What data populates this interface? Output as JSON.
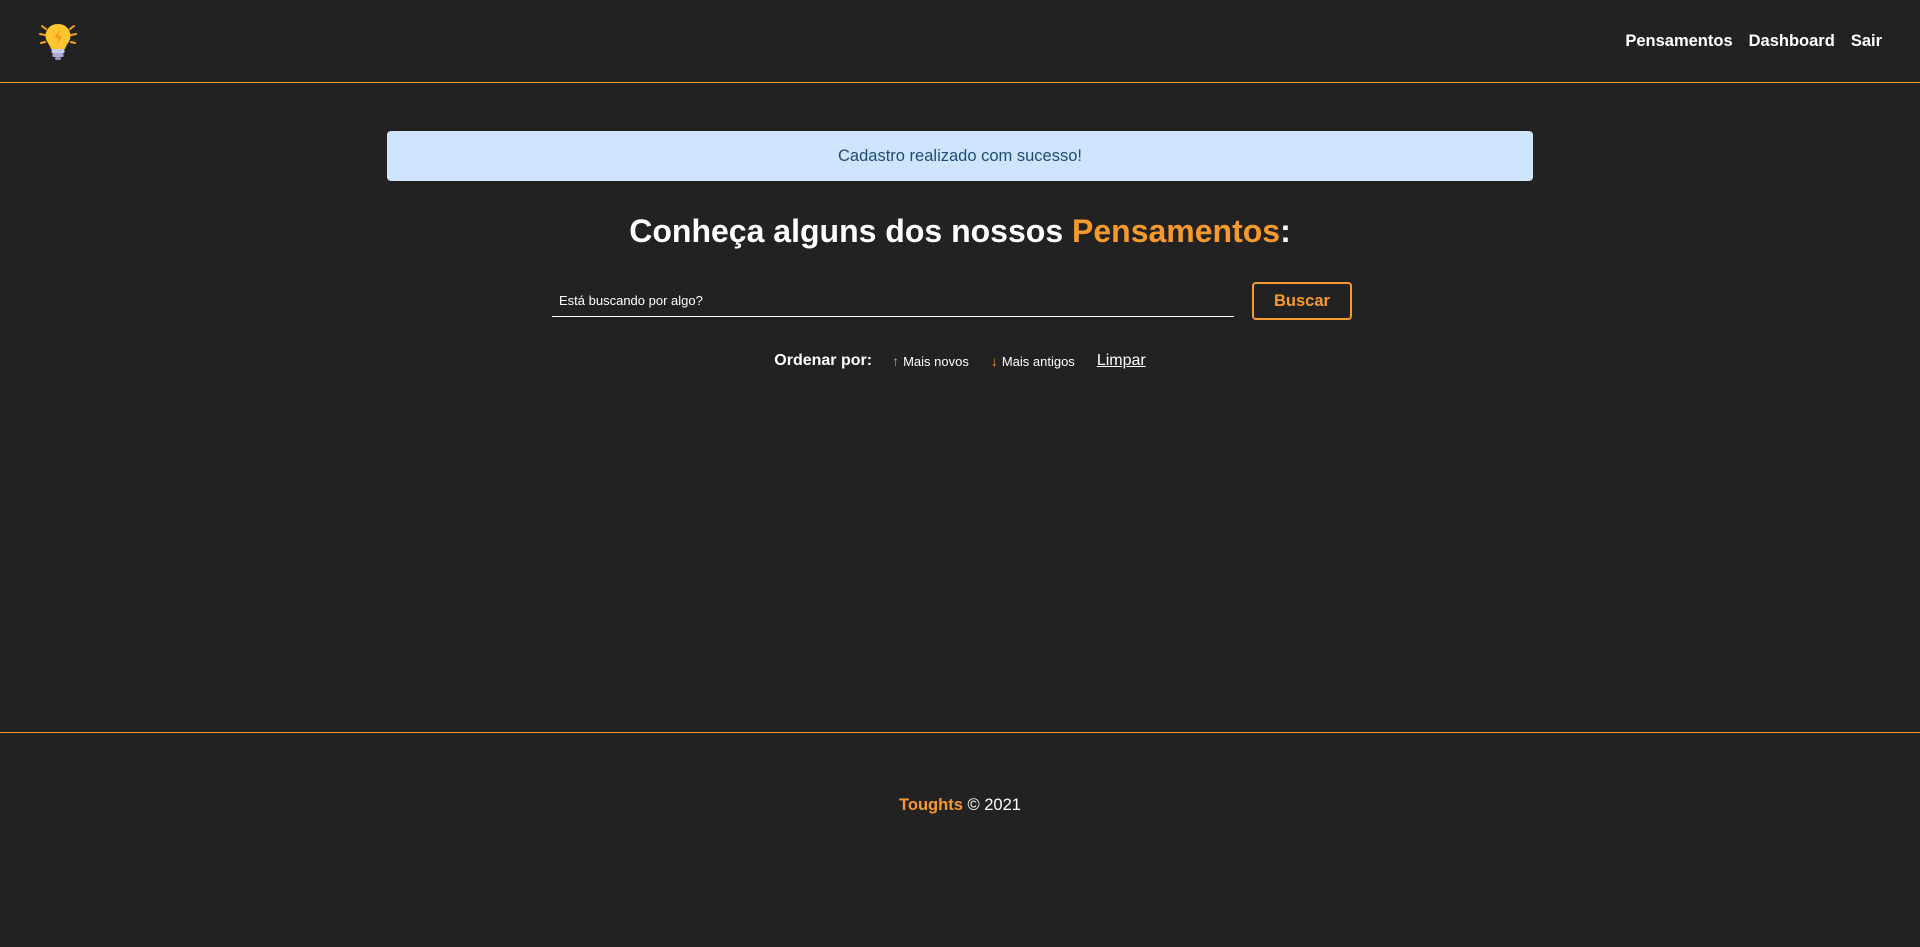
{
  "navbar": {
    "logo_icon": "light-bulb-icon",
    "links": [
      {
        "label": "Pensamentos"
      },
      {
        "label": "Dashboard"
      },
      {
        "label": "Sair"
      }
    ]
  },
  "flash": {
    "message": "Cadastro realizado com sucesso!"
  },
  "headline": {
    "prefix": "Conheça alguns dos nossos ",
    "highlight": "Pensamentos",
    "suffix": ":"
  },
  "search": {
    "placeholder": "Está buscando por algo?",
    "button_label": "Buscar"
  },
  "order": {
    "label": "Ordenar por:",
    "newest_arrow": "↑",
    "newest_label": "Mais novos",
    "oldest_arrow": "↓",
    "oldest_label": "Mais antigos",
    "clear_label": "Limpar"
  },
  "footer": {
    "brand": "Toughts",
    "copyright": " © 2021"
  },
  "colors": {
    "background": "#222222",
    "accent": "#f79a2e",
    "flash_bg": "#cfe5fd",
    "flash_text": "#1f4b78"
  }
}
